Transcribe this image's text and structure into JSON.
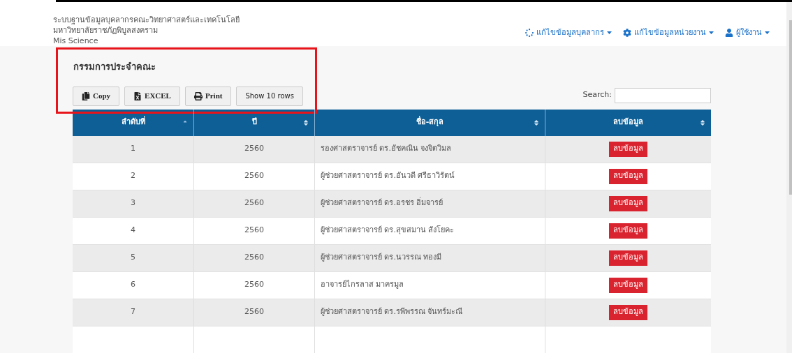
{
  "header": {
    "title_lines": [
      "ระบบฐานข้อมูลบุคลากรคณะวิทยาศาสตร์และเทคโนโลยี",
      "มหาวิทยาลัยราชภัฏพิบูลสงคราม",
      "Mis Science"
    ],
    "nav": [
      {
        "kind": "spinner",
        "label": "แก้ไขข้อมูลบุคลากร"
      },
      {
        "kind": "gear",
        "label": "แก้ไขข้อมูลหน่วยงาน"
      },
      {
        "kind": "user",
        "label": "ผู้ใช้งาน"
      }
    ]
  },
  "section_title": "กรรมการประจำคณะ",
  "toolbar": [
    {
      "kind": "copy",
      "label": "Copy"
    },
    {
      "kind": "excel",
      "label": "EXCEL"
    },
    {
      "kind": "print",
      "label": "Print"
    },
    {
      "kind": "plain",
      "label": "Show 10 rows"
    }
  ],
  "search": {
    "label": "Search:"
  },
  "table": {
    "columns": [
      {
        "label": "ลำดับที่",
        "sorted": true
      },
      {
        "label": "ปี",
        "sorted": false
      },
      {
        "label": "ชื่อ-สกุล",
        "sorted": false
      },
      {
        "label": "ลบข้อมูล",
        "sorted": false
      }
    ],
    "rows": [
      {
        "no": "1",
        "year": "2560",
        "name": "รองศาสตราจารย์ ดร.อัชคณิน จงจิตวิมล",
        "action": "ลบข้อมูล"
      },
      {
        "no": "2",
        "year": "2560",
        "name": "ผู้ช่วยศาสตราจารย์ ดร.อันวดี ศรีธาวิรัตน์",
        "action": "ลบข้อมูล"
      },
      {
        "no": "3",
        "year": "2560",
        "name": "ผู้ช่วยศาสตราจารย์ ดร.อรชร อิ่มจารย์",
        "action": "ลบข้อมูล"
      },
      {
        "no": "4",
        "year": "2560",
        "name": "ผู้ช่วยศาสตราจารย์ ดร.สุขสมาน สังโยคะ",
        "action": "ลบข้อมูล"
      },
      {
        "no": "5",
        "year": "2560",
        "name": "ผู้ช่วยศาสตราจารย์ ดร.นวรรณ ทองมี",
        "action": "ลบข้อมูล"
      },
      {
        "no": "6",
        "year": "2560",
        "name": "อาจารย์ไกรลาส มาครมูล",
        "action": "ลบข้อมูล"
      },
      {
        "no": "7",
        "year": "2560",
        "name": "ผู้ช่วยศาสตราจารย์ ดร.รพีพรรณ จันทร์มะณี",
        "action": "ลบข้อมูล"
      }
    ]
  }
}
